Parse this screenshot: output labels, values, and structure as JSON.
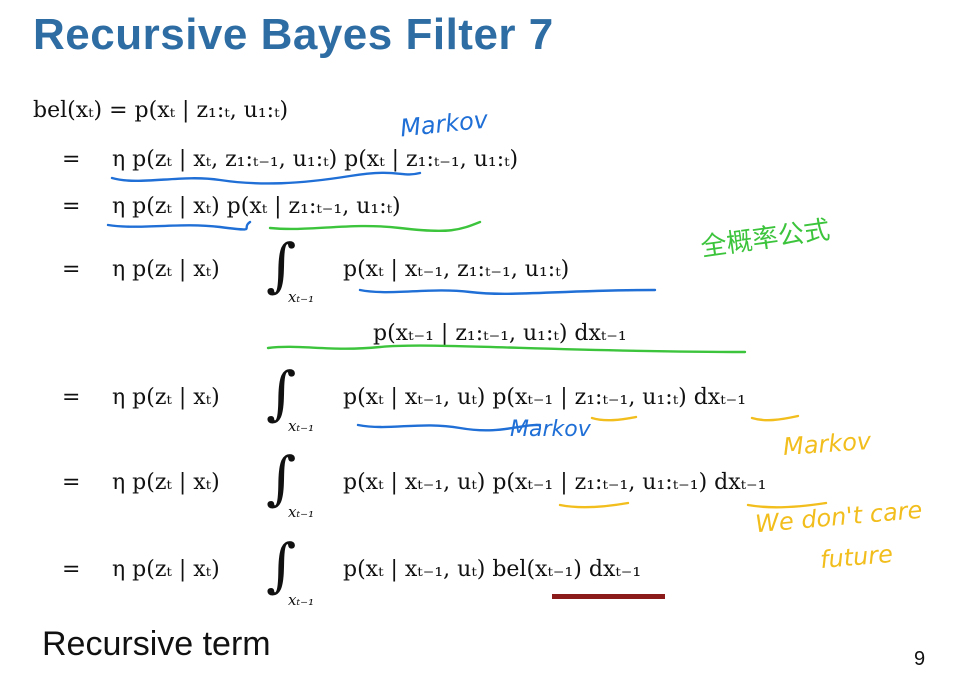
{
  "slide": {
    "title": "Recursive Bayes Filter 7",
    "page_number": "9",
    "footer_label": "Recursive term"
  },
  "derivation": {
    "lhs": "bel(xₜ) = p(xₜ | z₁:ₜ, u₁:ₜ)",
    "equals": "=",
    "integral_sign": "∫",
    "integral_subscript": "xₜ₋₁",
    "line1": "η p(zₜ | xₜ, z₁:ₜ₋₁, u₁:ₜ) p(xₜ | z₁:ₜ₋₁, u₁:ₜ)",
    "line2": "η p(zₜ | xₜ) p(xₜ | z₁:ₜ₋₁, u₁:ₜ)",
    "line3_prefix": "η p(zₜ | xₜ)",
    "line3_integrand": "p(xₜ | xₜ₋₁, z₁:ₜ₋₁, u₁:ₜ)",
    "line3_continuation": "p(xₜ₋₁ | z₁:ₜ₋₁, u₁:ₜ) dxₜ₋₁",
    "line4_prefix": "η p(zₜ | xₜ)",
    "line4_integrand": "p(xₜ | xₜ₋₁, uₜ) p(xₜ₋₁ | z₁:ₜ₋₁, u₁:ₜ) dxₜ₋₁",
    "line5_prefix": "η p(zₜ | xₜ)",
    "line5_integrand": "p(xₜ | xₜ₋₁, uₜ) p(xₜ₋₁ | z₁:ₜ₋₁, u₁:ₜ₋₁) dxₜ₋₁",
    "line6_prefix": "η p(zₜ | xₜ)",
    "line6_integrand": "p(xₜ | xₜ₋₁, uₜ) bel(xₜ₋₁) dxₜ₋₁"
  },
  "annotations": {
    "markov_1": "Markov",
    "total_probability": "全概率公式",
    "markov_2": "Markov",
    "markov_3": "Markov",
    "we_dont_care": "We don't care",
    "future": "future"
  },
  "colors": {
    "title": "#2e6da4",
    "blue_ink": "#1f6fd6",
    "green_ink": "#3cc43c",
    "yellow_ink": "#f2be1e",
    "dark_red": "#8b1a1a"
  }
}
